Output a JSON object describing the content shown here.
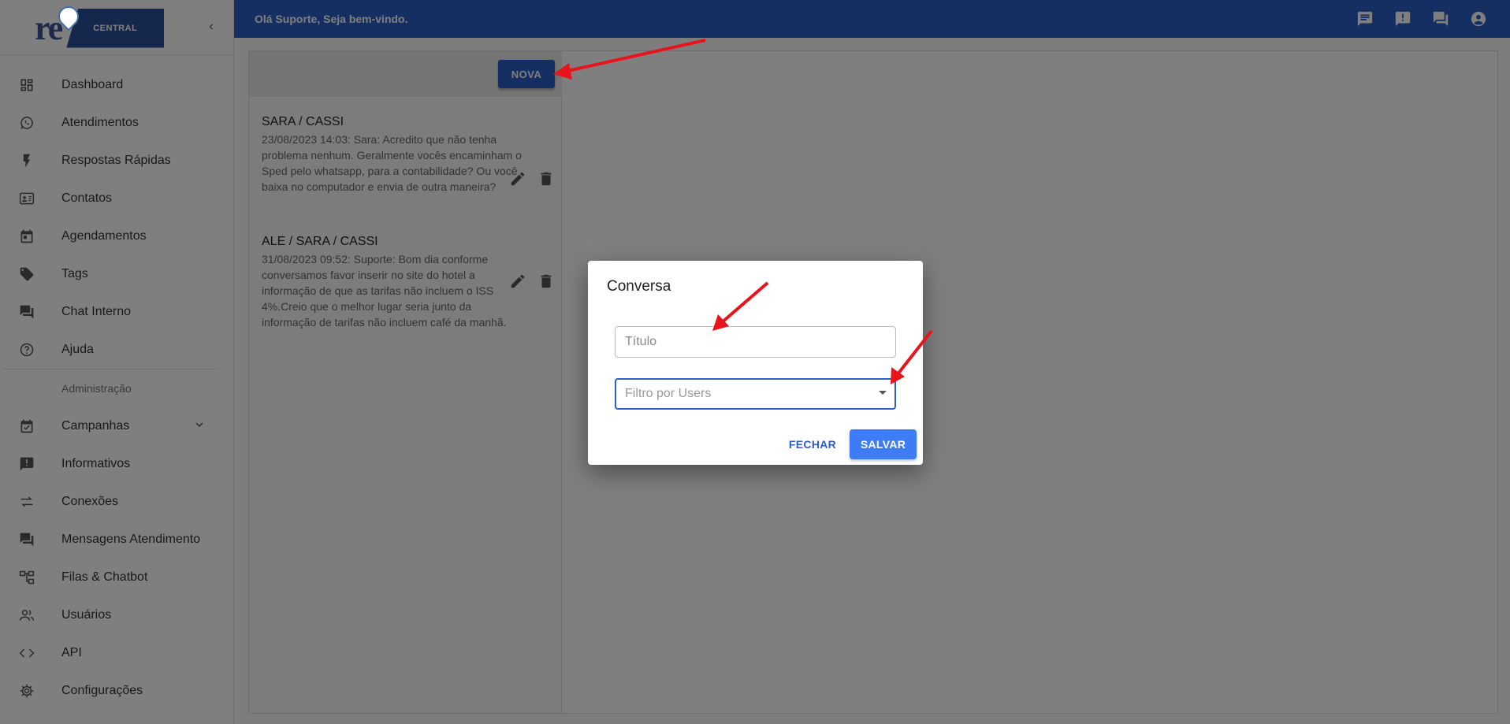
{
  "logo": {
    "text": "re",
    "badge": "CENTRAL"
  },
  "topbar": {
    "welcome": "Olá Suporte, Seja bem-vindo."
  },
  "sidebar": {
    "items": [
      {
        "label": "Dashboard",
        "icon": "dashboard-icon"
      },
      {
        "label": "Atendimentos",
        "icon": "whatsapp-icon"
      },
      {
        "label": "Respostas Rápidas",
        "icon": "flash-icon"
      },
      {
        "label": "Contatos",
        "icon": "contact-card-icon"
      },
      {
        "label": "Agendamentos",
        "icon": "calendar-icon"
      },
      {
        "label": "Tags",
        "icon": "tag-icon"
      },
      {
        "label": "Chat Interno",
        "icon": "chat-icon"
      },
      {
        "label": "Ajuda",
        "icon": "help-icon"
      }
    ],
    "admin_header": "Administração",
    "admin_items": [
      {
        "label": "Campanhas",
        "icon": "event-check-icon"
      },
      {
        "label": "Informativos",
        "icon": "announcement-icon"
      },
      {
        "label": "Conexões",
        "icon": "swap-icon"
      },
      {
        "label": "Mensagens Atendimento",
        "icon": "forum-icon"
      },
      {
        "label": "Filas & Chatbot",
        "icon": "account-tree-icon"
      },
      {
        "label": "Usuários",
        "icon": "people-icon"
      },
      {
        "label": "API",
        "icon": "code-icon"
      },
      {
        "label": "Configurações",
        "icon": "settings-icon"
      }
    ]
  },
  "list": {
    "new_button": "NOVA",
    "chats": [
      {
        "title": "SARA / CASSI",
        "preview": "23/08/2023 14:03: Sara: Acredito que não tenha problema nenhum. Geralmente vocês encaminham o Sped pelo whatsapp, para a contabilidade? Ou você baixa no computador e envia de outra maneira?"
      },
      {
        "title": "ALE / SARA / CASSI",
        "preview": "31/08/2023 09:52: Suporte: Bom dia conforme conversamos favor inserir no site do hotel a informação de que as tarifas não incluem o ISS 4%.Creio que o melhor lugar seria junto da informação de tarifas não incluem café da manhã."
      }
    ]
  },
  "dialog": {
    "title": "Conversa",
    "title_placeholder": "Título",
    "users_placeholder": "Filtro por Users",
    "close_label": "FECHAR",
    "save_label": "SALVAR"
  },
  "colors": {
    "primary": "#2d5fc4",
    "save": "#3d7cf5",
    "arrow": "#e8131b"
  }
}
